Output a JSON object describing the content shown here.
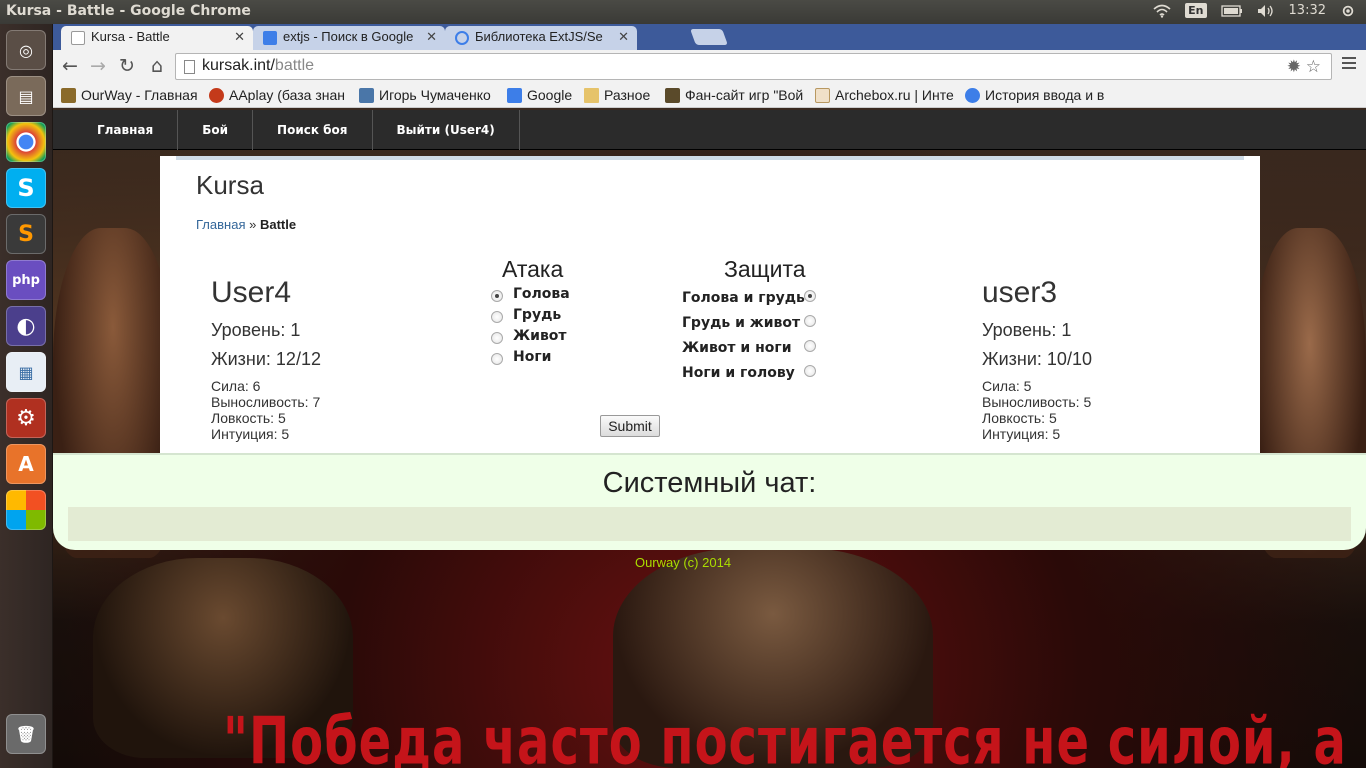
{
  "os": {
    "window_title": "Kursa - Battle - Google Chrome",
    "lang": "En",
    "time": "13:32"
  },
  "tabs": [
    {
      "label": "Kursa - Battle",
      "active": true
    },
    {
      "label": "extjs - Поиск в Google",
      "active": false
    },
    {
      "label": "Библиотека ExtJS/Se",
      "active": false
    }
  ],
  "address": {
    "host": "kursak.int/",
    "path": "battle"
  },
  "bookmarks": [
    {
      "label": "OurWay - Главная",
      "icon": "ourway-icon"
    },
    {
      "label": "AAplay (база знан",
      "icon": "aaplay-icon"
    },
    {
      "label": "Игорь Чумаченко",
      "icon": "vk-icon"
    },
    {
      "label": "Google",
      "icon": "google-icon"
    },
    {
      "label": "Разное",
      "icon": "folder-icon"
    },
    {
      "label": "Фан-сайт игр \"Вой",
      "icon": "fansite-icon"
    },
    {
      "label": "Archebox.ru | Инте",
      "icon": "archebox-icon"
    },
    {
      "label": "История ввода и в",
      "icon": "history-icon"
    }
  ],
  "site_nav": [
    "Главная",
    "Бой",
    "Поиск боя",
    "Выйти (User4)"
  ],
  "site": {
    "title": "Kursa",
    "crumb_home": "Главная",
    "crumb_sep": "»",
    "crumb_current": "Battle"
  },
  "player": {
    "name": "User4",
    "level": "Уровень: 1",
    "hp": "Жизни: 12/12",
    "stats": [
      "Сила: 6",
      "Выносливость: 7",
      "Ловкость: 5",
      "Интуиция: 5"
    ]
  },
  "opponent": {
    "name": "user3",
    "level": "Уровень: 1",
    "hp": "Жизни: 10/10",
    "stats": [
      "Сила: 5",
      "Выносливость: 5",
      "Ловкость: 5",
      "Интуиция: 5"
    ]
  },
  "attack": {
    "title": "Атака",
    "options": [
      "Голова",
      "Грудь",
      "Живот",
      "Ноги"
    ],
    "selected": "Голова"
  },
  "defense": {
    "title": "Защита",
    "options": [
      "Голова и грудь",
      "Грудь и живот",
      "Живот и ноги",
      "Ноги и голову"
    ],
    "selected": "Голова и грудь"
  },
  "submit_label": "Submit",
  "chat": {
    "title": "Системный чат:"
  },
  "footer": "Ourway (c) 2014",
  "poster_quote": "\"Победа часто постигается не силой, а волей\" (Спартак)",
  "colors": {
    "accent_link": "#336699",
    "footer": "#aadd00",
    "quote": "#c5141a",
    "chat_bg": "#efffe8"
  }
}
